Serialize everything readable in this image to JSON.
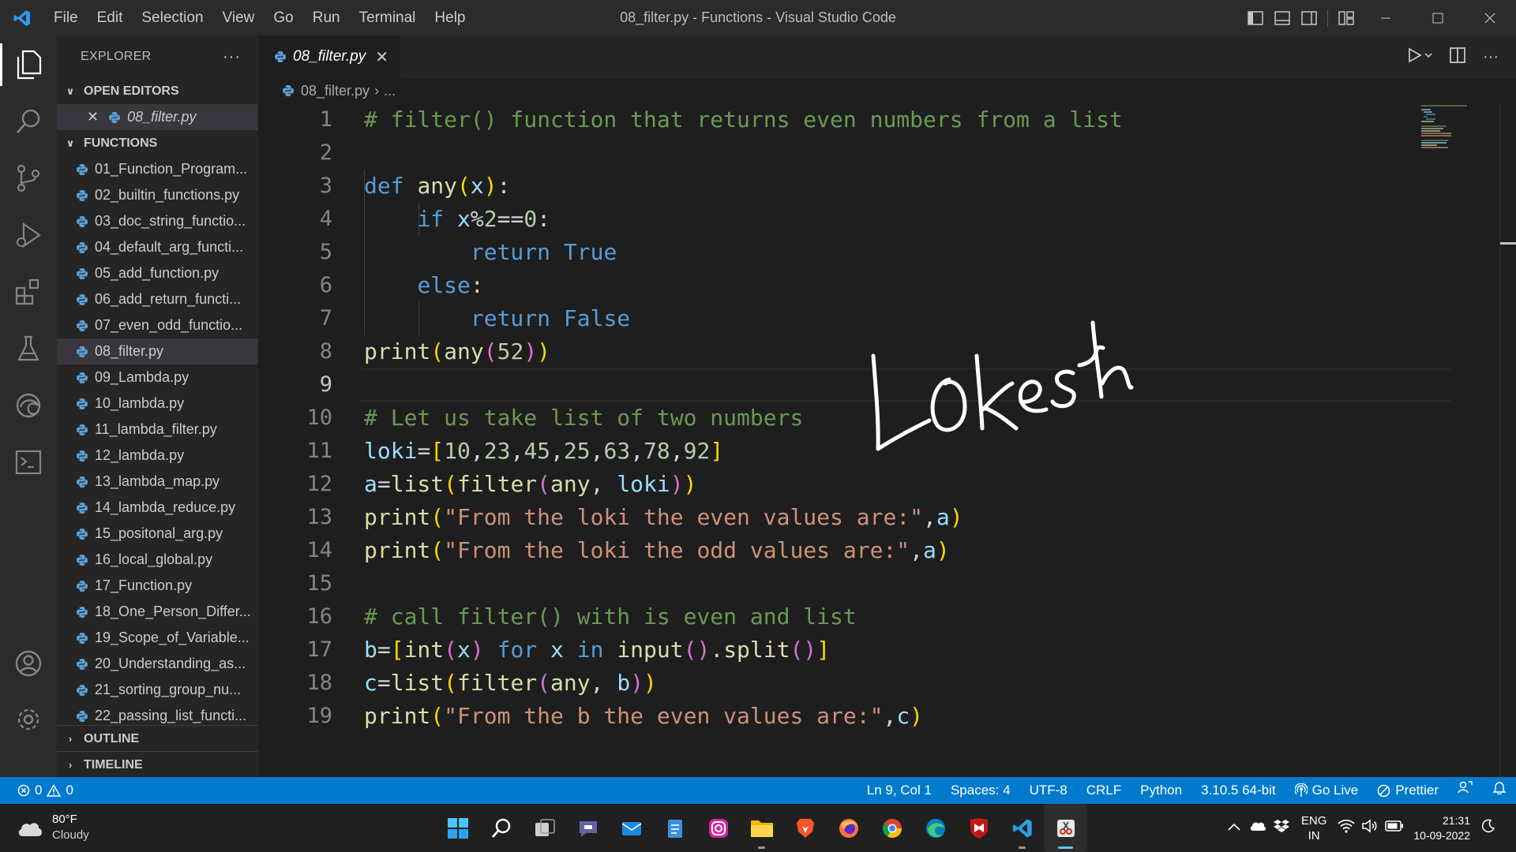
{
  "titlebar": {
    "menu": [
      "File",
      "Edit",
      "Selection",
      "View",
      "Go",
      "Run",
      "Terminal",
      "Help"
    ],
    "window_title": "08_filter.py - Functions - Visual Studio Code"
  },
  "sidebar": {
    "title": "EXPLORER",
    "open_editors_label": "OPEN EDITORS",
    "open_editor_file": "08_filter.py",
    "folder_label": "FUNCTIONS",
    "files": [
      "01_Function_Program...",
      "02_builtin_functions.py",
      "03_doc_string_functio...",
      "04_default_arg_functi...",
      "05_add_function.py",
      "06_add_return_functi...",
      "07_even_odd_functio...",
      "08_filter.py",
      "09_Lambda.py",
      "10_lambda.py",
      "11_lambda_filter.py",
      "12_lambda.py",
      "13_lambda_map.py",
      "14_lambda_reduce.py",
      "15_positonal_arg.py",
      "16_local_global.py",
      "17_Function.py",
      "18_One_Person_Differ...",
      "19_Scope_of_Variable...",
      "20_Understanding_as...",
      "21_sorting_group_nu...",
      "22_passing_list_functi..."
    ],
    "outline_label": "OUTLINE",
    "timeline_label": "TIMELINE"
  },
  "tab": {
    "label": "08_filter.py"
  },
  "breadcrumb": {
    "file": "08_filter.py",
    "rest": "..."
  },
  "editor": {
    "line_numbers": [
      "1",
      "2",
      "3",
      "4",
      "5",
      "6",
      "7",
      "8",
      "9",
      "10",
      "11",
      "12",
      "13",
      "14",
      "15",
      "16",
      "17",
      "18",
      "19"
    ],
    "current_line": 9,
    "handwriting": "Lokesh"
  },
  "statusbar": {
    "errors": "0",
    "warnings": "0",
    "position": "Ln 9, Col 1",
    "spaces": "Spaces: 4",
    "encoding": "UTF-8",
    "eol": "CRLF",
    "language": "Python",
    "interpreter": "3.10.5 64-bit",
    "golive": "Go Live",
    "prettier": "Prettier"
  },
  "taskbar": {
    "temp": "80°F",
    "condition": "Cloudy",
    "lang1": "ENG",
    "lang2": "IN",
    "time": "21:31",
    "date": "10-09-2022"
  },
  "colors": {
    "accent": "#007acc",
    "keyword": "#569cd6",
    "function": "#dcdcaa",
    "string": "#ce9178",
    "comment": "#6a9955",
    "number": "#b5cea8"
  }
}
